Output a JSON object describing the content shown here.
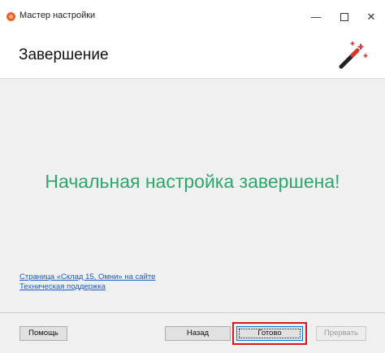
{
  "window": {
    "title": "Мастер настройки",
    "controls": {
      "minimize": "—",
      "close": "✕"
    }
  },
  "header": {
    "title": "Завершение",
    "icon": "magic-wand-icon"
  },
  "content": {
    "message": "Начальная настройка завершена!",
    "links": [
      "Страница «Склад 15, Омни» на сайте",
      "Техническая поддержка"
    ]
  },
  "footer": {
    "help_label": "Помощь",
    "back_label": "Назад",
    "finish_label": "Готово",
    "cancel_label": "Прервать"
  },
  "colors": {
    "accent_green": "#2ea66a",
    "link_blue": "#1a5bc4",
    "highlight_red": "#e0141c",
    "app_icon": "#e8622c"
  }
}
